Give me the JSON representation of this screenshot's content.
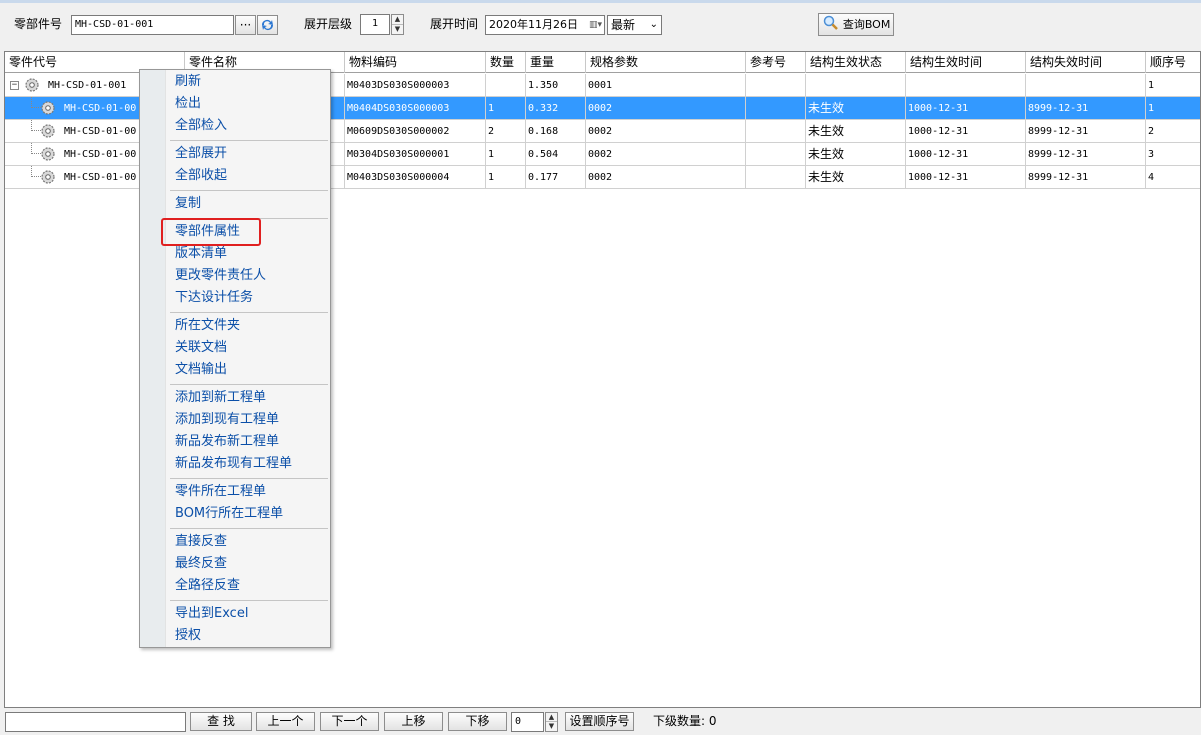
{
  "toolbar": {
    "part_label": "零部件号",
    "part_value": "MH-CSD-01-001",
    "browse_label": "···",
    "level_label": "展开层级",
    "level_value": "1",
    "time_label": "展开时间",
    "date_value": "2020年11月26日",
    "version_value": "最新",
    "query_label": "查询BOM"
  },
  "grid": {
    "columns": [
      "零件代号",
      "零件名称",
      "物料编码",
      "数量",
      "重量",
      "规格参数",
      "参考号",
      "结构生效状态",
      "结构生效时间",
      "结构失效时间",
      "顺序号"
    ],
    "rows": [
      {
        "code": "MH-CSD-01-001",
        "material": "M0403DS030S000003",
        "qty": "",
        "weight": "1.350",
        "spec": "0001",
        "ref": "",
        "status": "",
        "start": "",
        "end": "",
        "seq": "1"
      },
      {
        "code": "MH-CSD-01-00",
        "material": "M0404DS030S000003",
        "qty": "1",
        "weight": "0.332",
        "spec": "0002",
        "ref": "",
        "status": "未生效",
        "start": "1000-12-31",
        "end": "8999-12-31",
        "seq": "1"
      },
      {
        "code": "MH-CSD-01-00",
        "material": "M0609DS030S000002",
        "qty": "2",
        "weight": "0.168",
        "spec": "0002",
        "ref": "",
        "status": "未生效",
        "start": "1000-12-31",
        "end": "8999-12-31",
        "seq": "2"
      },
      {
        "code": "MH-CSD-01-00",
        "material": "M0304DS030S000001",
        "qty": "1",
        "weight": "0.504",
        "spec": "0002",
        "ref": "",
        "status": "未生效",
        "start": "1000-12-31",
        "end": "8999-12-31",
        "seq": "3"
      },
      {
        "code": "MH-CSD-01-00",
        "material": "M0403DS030S000004",
        "qty": "1",
        "weight": "0.177",
        "spec": "0002",
        "ref": "",
        "status": "未生效",
        "start": "1000-12-31",
        "end": "8999-12-31",
        "seq": "4"
      }
    ]
  },
  "context_menu": {
    "items": [
      "刷新",
      "检出",
      "全部检入",
      "全部展开",
      "全部收起",
      "复制",
      "零部件属性",
      "版本清单",
      "更改零件责任人",
      "下达设计任务",
      "所在文件夹",
      "关联文档",
      "文档输出",
      "添加到新工程单",
      "添加到现有工程单",
      "新品发布新工程单",
      "新品发布现有工程单",
      "零件所在工程单",
      "BOM行所在工程单",
      "直接反查",
      "最终反查",
      "全路径反查",
      "导出到Excel",
      "授权"
    ],
    "highlighted": "零部件属性",
    "highlight_color": "#e02020"
  },
  "bottom": {
    "search_value": "",
    "find_label": "查 找",
    "prev_label": "上一个",
    "next_label": "下一个",
    "move_up_label": "上移",
    "move_down_label": "下移",
    "order_value": "0",
    "set_order_label": "设置顺序号",
    "sub_count_label": "下级数量: 0"
  },
  "colors": {
    "selection": "#3399ff",
    "menu_text": "#0b4fa8"
  }
}
